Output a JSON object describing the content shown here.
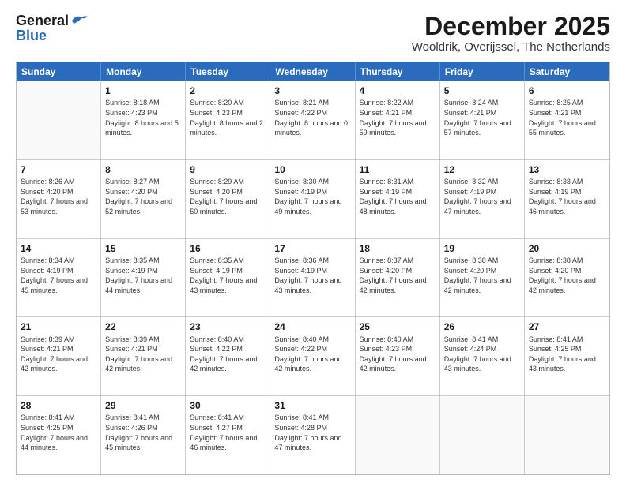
{
  "header": {
    "logo_general": "General",
    "logo_blue": "Blue",
    "month_title": "December 2025",
    "location": "Wooldrik, Overijssel, The Netherlands"
  },
  "days_of_week": [
    "Sunday",
    "Monday",
    "Tuesday",
    "Wednesday",
    "Thursday",
    "Friday",
    "Saturday"
  ],
  "weeks": [
    [
      {
        "day": "",
        "sunrise": "",
        "sunset": "",
        "daylight": "",
        "empty": true
      },
      {
        "day": "1",
        "sunrise": "Sunrise: 8:18 AM",
        "sunset": "Sunset: 4:23 PM",
        "daylight": "Daylight: 8 hours and 5 minutes."
      },
      {
        "day": "2",
        "sunrise": "Sunrise: 8:20 AM",
        "sunset": "Sunset: 4:23 PM",
        "daylight": "Daylight: 8 hours and 2 minutes."
      },
      {
        "day": "3",
        "sunrise": "Sunrise: 8:21 AM",
        "sunset": "Sunset: 4:22 PM",
        "daylight": "Daylight: 8 hours and 0 minutes."
      },
      {
        "day": "4",
        "sunrise": "Sunrise: 8:22 AM",
        "sunset": "Sunset: 4:21 PM",
        "daylight": "Daylight: 7 hours and 59 minutes."
      },
      {
        "day": "5",
        "sunrise": "Sunrise: 8:24 AM",
        "sunset": "Sunset: 4:21 PM",
        "daylight": "Daylight: 7 hours and 57 minutes."
      },
      {
        "day": "6",
        "sunrise": "Sunrise: 8:25 AM",
        "sunset": "Sunset: 4:21 PM",
        "daylight": "Daylight: 7 hours and 55 minutes."
      }
    ],
    [
      {
        "day": "7",
        "sunrise": "Sunrise: 8:26 AM",
        "sunset": "Sunset: 4:20 PM",
        "daylight": "Daylight: 7 hours and 53 minutes."
      },
      {
        "day": "8",
        "sunrise": "Sunrise: 8:27 AM",
        "sunset": "Sunset: 4:20 PM",
        "daylight": "Daylight: 7 hours and 52 minutes."
      },
      {
        "day": "9",
        "sunrise": "Sunrise: 8:29 AM",
        "sunset": "Sunset: 4:20 PM",
        "daylight": "Daylight: 7 hours and 50 minutes."
      },
      {
        "day": "10",
        "sunrise": "Sunrise: 8:30 AM",
        "sunset": "Sunset: 4:19 PM",
        "daylight": "Daylight: 7 hours and 49 minutes."
      },
      {
        "day": "11",
        "sunrise": "Sunrise: 8:31 AM",
        "sunset": "Sunset: 4:19 PM",
        "daylight": "Daylight: 7 hours and 48 minutes."
      },
      {
        "day": "12",
        "sunrise": "Sunrise: 8:32 AM",
        "sunset": "Sunset: 4:19 PM",
        "daylight": "Daylight: 7 hours and 47 minutes."
      },
      {
        "day": "13",
        "sunrise": "Sunrise: 8:33 AM",
        "sunset": "Sunset: 4:19 PM",
        "daylight": "Daylight: 7 hours and 46 minutes."
      }
    ],
    [
      {
        "day": "14",
        "sunrise": "Sunrise: 8:34 AM",
        "sunset": "Sunset: 4:19 PM",
        "daylight": "Daylight: 7 hours and 45 minutes."
      },
      {
        "day": "15",
        "sunrise": "Sunrise: 8:35 AM",
        "sunset": "Sunset: 4:19 PM",
        "daylight": "Daylight: 7 hours and 44 minutes."
      },
      {
        "day": "16",
        "sunrise": "Sunrise: 8:35 AM",
        "sunset": "Sunset: 4:19 PM",
        "daylight": "Daylight: 7 hours and 43 minutes."
      },
      {
        "day": "17",
        "sunrise": "Sunrise: 8:36 AM",
        "sunset": "Sunset: 4:19 PM",
        "daylight": "Daylight: 7 hours and 43 minutes."
      },
      {
        "day": "18",
        "sunrise": "Sunrise: 8:37 AM",
        "sunset": "Sunset: 4:20 PM",
        "daylight": "Daylight: 7 hours and 42 minutes."
      },
      {
        "day": "19",
        "sunrise": "Sunrise: 8:38 AM",
        "sunset": "Sunset: 4:20 PM",
        "daylight": "Daylight: 7 hours and 42 minutes."
      },
      {
        "day": "20",
        "sunrise": "Sunrise: 8:38 AM",
        "sunset": "Sunset: 4:20 PM",
        "daylight": "Daylight: 7 hours and 42 minutes."
      }
    ],
    [
      {
        "day": "21",
        "sunrise": "Sunrise: 8:39 AM",
        "sunset": "Sunset: 4:21 PM",
        "daylight": "Daylight: 7 hours and 42 minutes."
      },
      {
        "day": "22",
        "sunrise": "Sunrise: 8:39 AM",
        "sunset": "Sunset: 4:21 PM",
        "daylight": "Daylight: 7 hours and 42 minutes."
      },
      {
        "day": "23",
        "sunrise": "Sunrise: 8:40 AM",
        "sunset": "Sunset: 4:22 PM",
        "daylight": "Daylight: 7 hours and 42 minutes."
      },
      {
        "day": "24",
        "sunrise": "Sunrise: 8:40 AM",
        "sunset": "Sunset: 4:22 PM",
        "daylight": "Daylight: 7 hours and 42 minutes."
      },
      {
        "day": "25",
        "sunrise": "Sunrise: 8:40 AM",
        "sunset": "Sunset: 4:23 PM",
        "daylight": "Daylight: 7 hours and 42 minutes."
      },
      {
        "day": "26",
        "sunrise": "Sunrise: 8:41 AM",
        "sunset": "Sunset: 4:24 PM",
        "daylight": "Daylight: 7 hours and 43 minutes."
      },
      {
        "day": "27",
        "sunrise": "Sunrise: 8:41 AM",
        "sunset": "Sunset: 4:25 PM",
        "daylight": "Daylight: 7 hours and 43 minutes."
      }
    ],
    [
      {
        "day": "28",
        "sunrise": "Sunrise: 8:41 AM",
        "sunset": "Sunset: 4:25 PM",
        "daylight": "Daylight: 7 hours and 44 minutes."
      },
      {
        "day": "29",
        "sunrise": "Sunrise: 8:41 AM",
        "sunset": "Sunset: 4:26 PM",
        "daylight": "Daylight: 7 hours and 45 minutes."
      },
      {
        "day": "30",
        "sunrise": "Sunrise: 8:41 AM",
        "sunset": "Sunset: 4:27 PM",
        "daylight": "Daylight: 7 hours and 46 minutes."
      },
      {
        "day": "31",
        "sunrise": "Sunrise: 8:41 AM",
        "sunset": "Sunset: 4:28 PM",
        "daylight": "Daylight: 7 hours and 47 minutes."
      },
      {
        "day": "",
        "sunrise": "",
        "sunset": "",
        "daylight": "",
        "empty": true
      },
      {
        "day": "",
        "sunrise": "",
        "sunset": "",
        "daylight": "",
        "empty": true
      },
      {
        "day": "",
        "sunrise": "",
        "sunset": "",
        "daylight": "",
        "empty": true
      }
    ]
  ]
}
